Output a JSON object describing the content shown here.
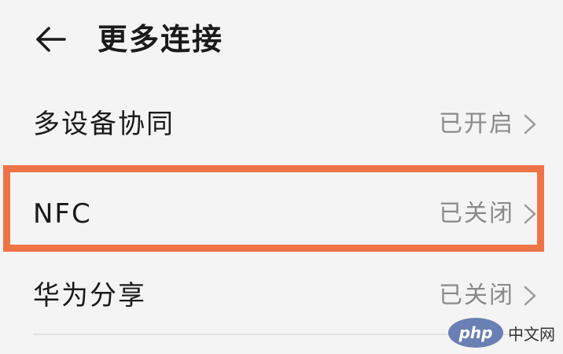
{
  "header": {
    "back_icon": "arrow-left-icon",
    "title": "更多连接"
  },
  "rows": [
    {
      "label": "多设备协同",
      "status": "已开启",
      "icon": "chevron-right-icon"
    },
    {
      "label": "NFC",
      "status": "已关闭",
      "icon": "chevron-right-icon",
      "highlighted": true
    },
    {
      "label": "华为分享",
      "status": "已关闭",
      "icon": "chevron-right-icon"
    }
  ],
  "highlight_color": "#ee7447",
  "watermark": {
    "logo": "php",
    "text": "中文网"
  }
}
